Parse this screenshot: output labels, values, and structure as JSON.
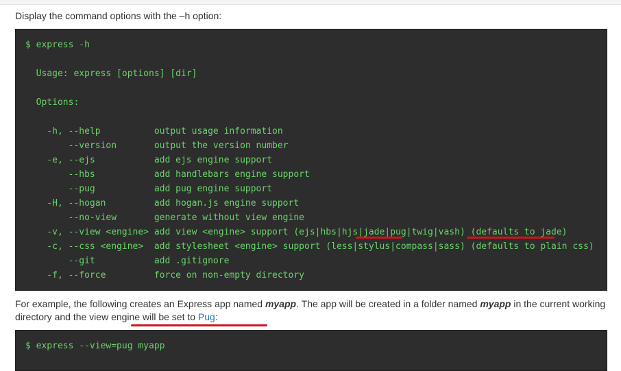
{
  "intro": {
    "text": "Display the command options with the –h option:"
  },
  "code1": {
    "text": "$ express -h\n\n  Usage: express [options] [dir]\n\n  Options:\n\n    -h, --help          output usage information\n        --version       output the version number\n    -e, --ejs           add ejs engine support\n        --hbs           add handlebars engine support\n        --pug           add pug engine support\n    -H, --hogan         add hogan.js engine support\n        --no-view       generate without view engine\n    -v, --view <engine> add view <engine> support (ejs|hbs|hjs|jade|pug|twig|vash) (defaults to jade)\n    -c, --css <engine>  add stylesheet <engine> support (less|stylus|compass|sass) (defaults to plain css)\n        --git           add .gitignore\n    -f, --force         force on non-empty directory"
  },
  "paragraph": {
    "t1": "For example, the following creates an Express app named ",
    "app1": "myapp",
    "t2": ". The app will be created in a folder named ",
    "app2": "myapp",
    "t3": " in the current working directory and the view engine will be set to ",
    "link": "Pug",
    "t4": ":"
  },
  "code2": {
    "text": "$ express --view=pug myapp"
  },
  "colors": {
    "code_background": "#2d2d2d",
    "code_text": "#6bd36b",
    "link": "#1a73c8",
    "annotation": "#d0141a"
  }
}
